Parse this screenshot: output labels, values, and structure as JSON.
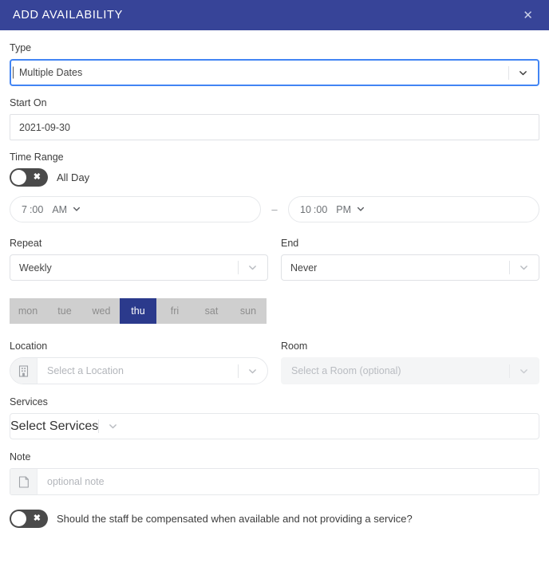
{
  "header": {
    "title": "ADD AVAILABILITY",
    "close_icon": "close-icon",
    "close_glyph": "✕",
    "background_color": "#374498"
  },
  "form": {
    "type": {
      "label": "Type",
      "value": "Multiple Dates",
      "focused": true,
      "focus_color": "#4285f4"
    },
    "start_on": {
      "label": "Start On",
      "value": "2021-09-30"
    },
    "time_range": {
      "label": "Time Range",
      "all_day": {
        "label": "All Day",
        "state_glyph": "✖",
        "enabled": false
      },
      "start": {
        "hour": "7",
        "minute": ":00",
        "meridiem": "AM"
      },
      "separator": "–",
      "end": {
        "hour": "10",
        "minute": ":00",
        "meridiem": "PM"
      }
    },
    "repeat": {
      "label": "Repeat",
      "value": "Weekly"
    },
    "end": {
      "label": "End",
      "value": "Never"
    },
    "days": [
      {
        "label": "mon",
        "selected": false
      },
      {
        "label": "tue",
        "selected": false
      },
      {
        "label": "wed",
        "selected": false
      },
      {
        "label": "thu",
        "selected": true
      },
      {
        "label": "fri",
        "selected": false
      },
      {
        "label": "sat",
        "selected": false
      },
      {
        "label": "sun",
        "selected": false
      }
    ],
    "selected_day_color": "#2b3a8c",
    "day_bar_color": "#cfcfcf",
    "location": {
      "label": "Location",
      "placeholder": "Select a Location",
      "icon": "building-icon"
    },
    "room": {
      "label": "Room",
      "placeholder": "Select a Room (optional)",
      "disabled": true
    },
    "services": {
      "label": "Services",
      "placeholder": "Select Services"
    },
    "note": {
      "label": "Note",
      "placeholder": "optional note",
      "icon": "note-icon"
    },
    "compensation": {
      "label": "Should the staff be compensated when available and not providing a service?",
      "state_glyph": "✖",
      "enabled": false
    }
  }
}
